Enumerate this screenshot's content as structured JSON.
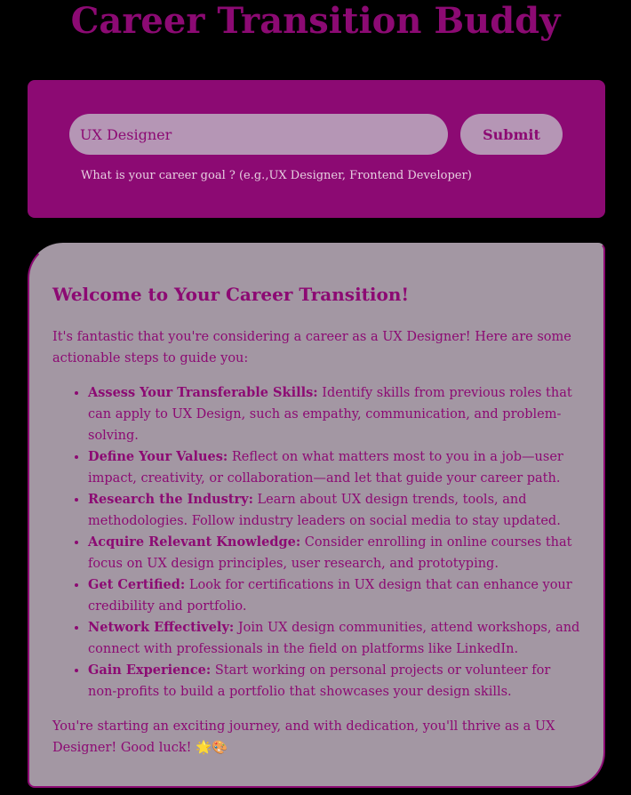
{
  "header": {
    "title": "Career Transition Buddy"
  },
  "form": {
    "input_value": "UX Designer",
    "submit_label": "Submit",
    "hint": "What is your career goal ? (e.g.,UX Designer, Frontend Developer)"
  },
  "result": {
    "heading": "Welcome to Your Career Transition!",
    "intro": "It's fantastic that you're considering a career as a UX Designer! Here are some actionable steps to guide you:",
    "steps": [
      {
        "title": "Assess Your Transferable Skills:",
        "text": " Identify skills from previous roles that can apply to UX Design, such as empathy, communication, and problem-solving."
      },
      {
        "title": "Define Your Values:",
        "text": " Reflect on what matters most to you in a job—user impact, creativity, or collaboration—and let that guide your career path."
      },
      {
        "title": "Research the Industry:",
        "text": " Learn about UX design trends, tools, and methodologies. Follow industry leaders on social media to stay updated."
      },
      {
        "title": "Acquire Relevant Knowledge:",
        "text": " Consider enrolling in online courses that focus on UX design principles, user research, and prototyping."
      },
      {
        "title": "Get Certified:",
        "text": " Look for certifications in UX design that can enhance your credibility and portfolio."
      },
      {
        "title": "Network Effectively:",
        "text": " Join UX design communities, attend workshops, and connect with professionals in the field on platforms like LinkedIn."
      },
      {
        "title": "Gain Experience:",
        "text": " Start working on personal projects or volunteer for non-profits to build a portfolio that showcases your design skills."
      }
    ],
    "outro": "You're starting an exciting journey, and with dedication, you'll thrive as a UX Designer! Good luck! 🌟🎨"
  },
  "colors": {
    "background": "#000000",
    "accent": "#8c0a73",
    "input_fill": "#b596b5",
    "card_fill": "#a397a3"
  }
}
